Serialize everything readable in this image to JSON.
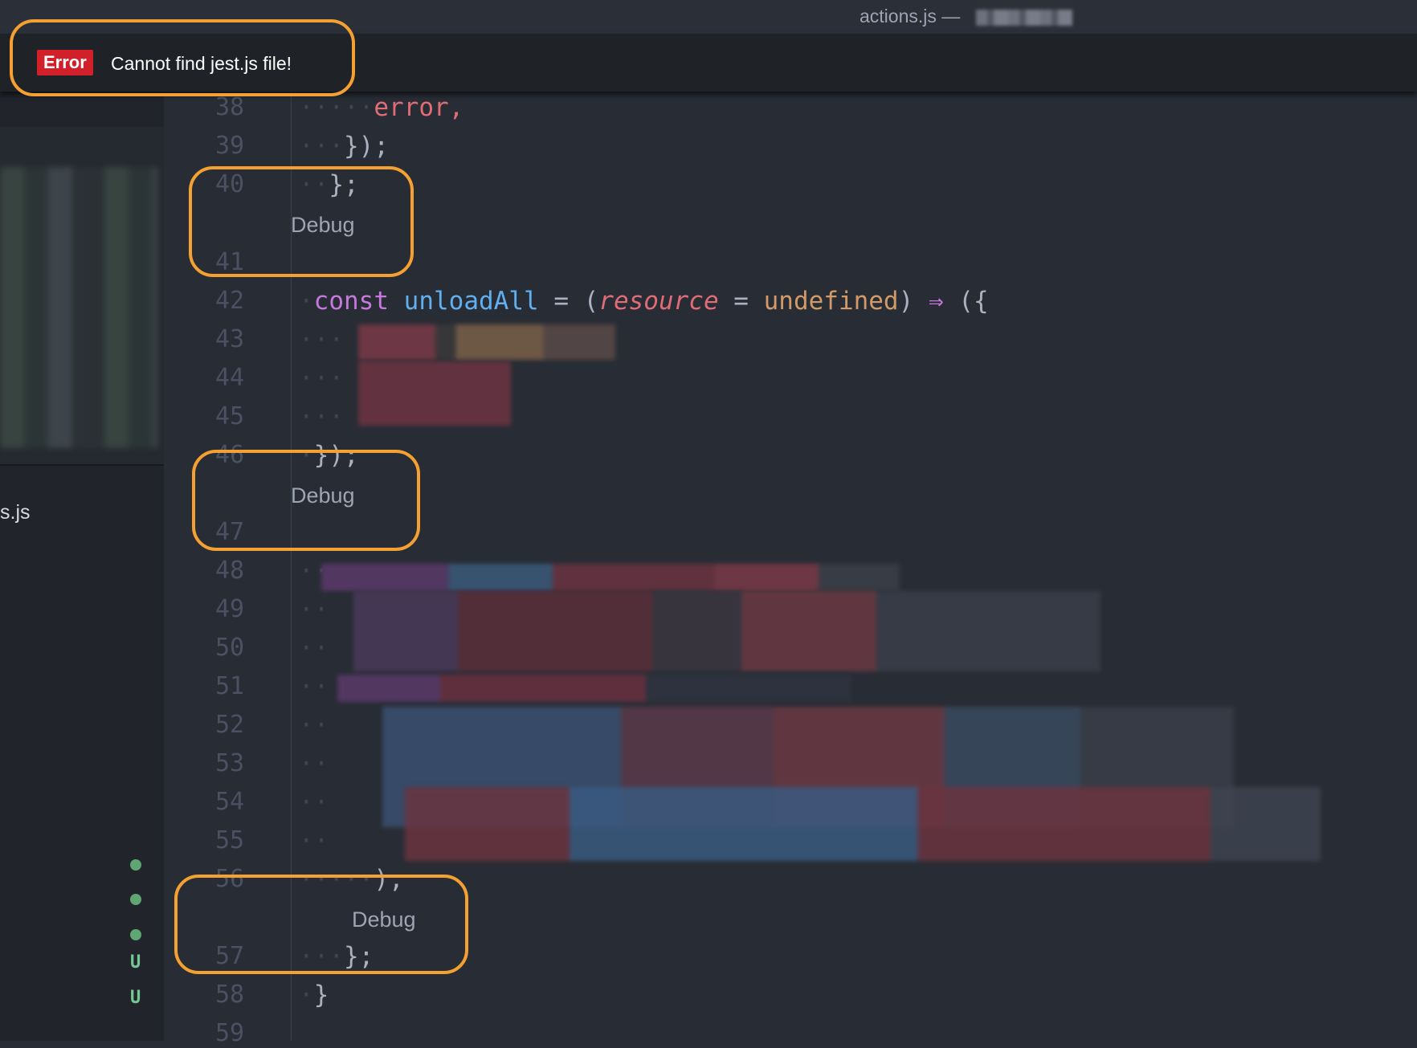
{
  "window": {
    "title": "actions.js —"
  },
  "notification": {
    "badge": "Error",
    "message": "Cannot find jest.js file!"
  },
  "sidebar": {
    "file_label": "s.js",
    "git_status": [
      "U",
      "U"
    ]
  },
  "editor": {
    "line_numbers": [
      "38",
      "39",
      "40",
      "41",
      "42",
      "43",
      "44",
      "45",
      "46",
      "47",
      "48",
      "49",
      "50",
      "51",
      "52",
      "53",
      "54",
      "55",
      "56",
      "57",
      "58",
      "59"
    ],
    "codelens_label": "Debug",
    "code": {
      "l38": "error,",
      "l39": "});",
      "l40": "};",
      "l42_const": "const",
      "l42_name": "unloadAll",
      "l42_eq": " = (",
      "l42_param": "resource",
      "l42_eq2": " = ",
      "l42_default": "undefined",
      "l42_close": ")",
      "l42_arrow": " ⇒ ",
      "l42_end": "({",
      "l46": "});",
      "l56": "),",
      "l57": "};",
      "l58": "}"
    }
  },
  "colors": {
    "highlight_ring": "#f5a033",
    "error_badge": "#d2202a",
    "editor_bg": "#282c34"
  }
}
